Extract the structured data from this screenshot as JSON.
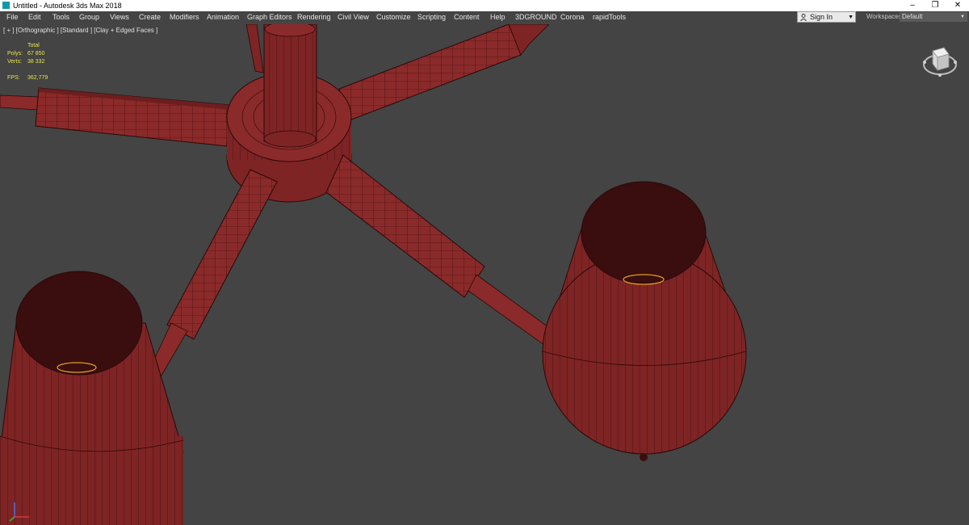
{
  "window": {
    "title": "Untitled - Autodesk 3ds Max 2018",
    "app_icon": "3ds-max-icon",
    "controls": {
      "minimize": "–",
      "restore": "❐",
      "close": "✕"
    }
  },
  "menu": {
    "items": [
      "File",
      "Edit",
      "Tools",
      "Group",
      "Views",
      "Create",
      "Modifiers",
      "Animation",
      "Graph Editors",
      "Rendering",
      "Civil View",
      "Customize",
      "Scripting",
      "Content",
      "Help",
      "3DGROUND",
      "Corona",
      "rapidTools"
    ]
  },
  "account": {
    "sign_in_label": "Sign In",
    "icon": "user-icon"
  },
  "workspaces": {
    "label": "Workspaces:",
    "value": "Default"
  },
  "viewport": {
    "label": "[ + ] [Orthographic ] [Standard ] [Clay + Edged Faces ]",
    "stats": {
      "header": "Total",
      "polys_label": "Polys:",
      "polys_value": "67 850",
      "verts_label": "Verts:",
      "verts_value": "38 332",
      "fps_label": "FPS:",
      "fps_value": "362,779"
    },
    "background": "#444444",
    "clay_color": "#8b2a2a",
    "wire_color": "#1a0505",
    "stats_color": "#e3e34a"
  }
}
